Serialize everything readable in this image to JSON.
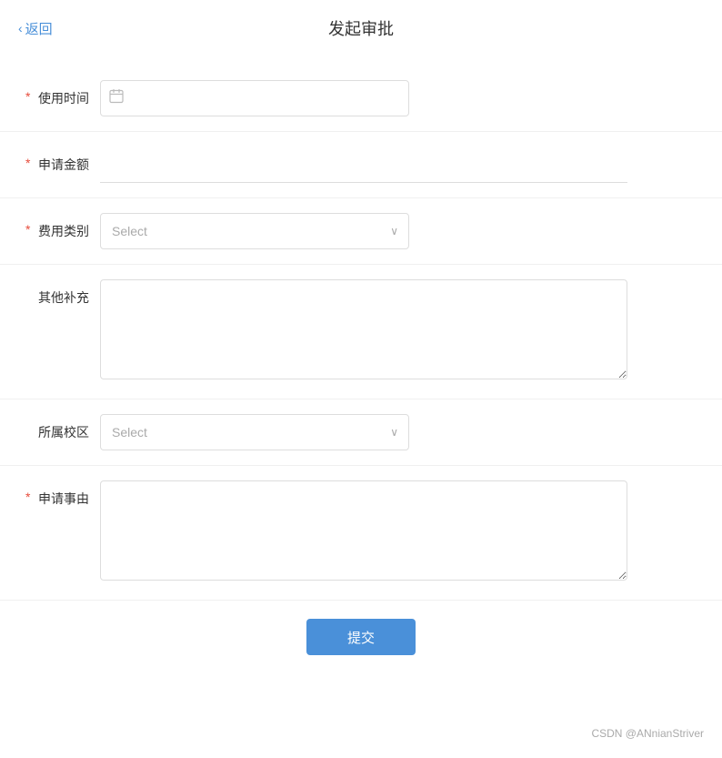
{
  "header": {
    "back_label": "返回",
    "title": "发起审批"
  },
  "form": {
    "fields": [
      {
        "id": "usage_time",
        "label": "使用时间",
        "required": true,
        "type": "date",
        "placeholder": ""
      },
      {
        "id": "amount",
        "label": "申请金额",
        "required": true,
        "type": "text",
        "placeholder": ""
      },
      {
        "id": "expense_type",
        "label": "费用类别",
        "required": true,
        "type": "select",
        "placeholder": "Select"
      },
      {
        "id": "other_supplement",
        "label": "其他补充",
        "required": false,
        "type": "textarea",
        "placeholder": ""
      },
      {
        "id": "campus",
        "label": "所属校区",
        "required": false,
        "type": "select",
        "placeholder": "Select"
      },
      {
        "id": "reason",
        "label": "申请事由",
        "required": true,
        "type": "textarea",
        "placeholder": ""
      }
    ],
    "submit_label": "提交"
  },
  "watermark": "CSDN @ANnianStriver",
  "icons": {
    "calendar": "📅",
    "chevron_down": "∨",
    "chevron_left": "‹"
  }
}
